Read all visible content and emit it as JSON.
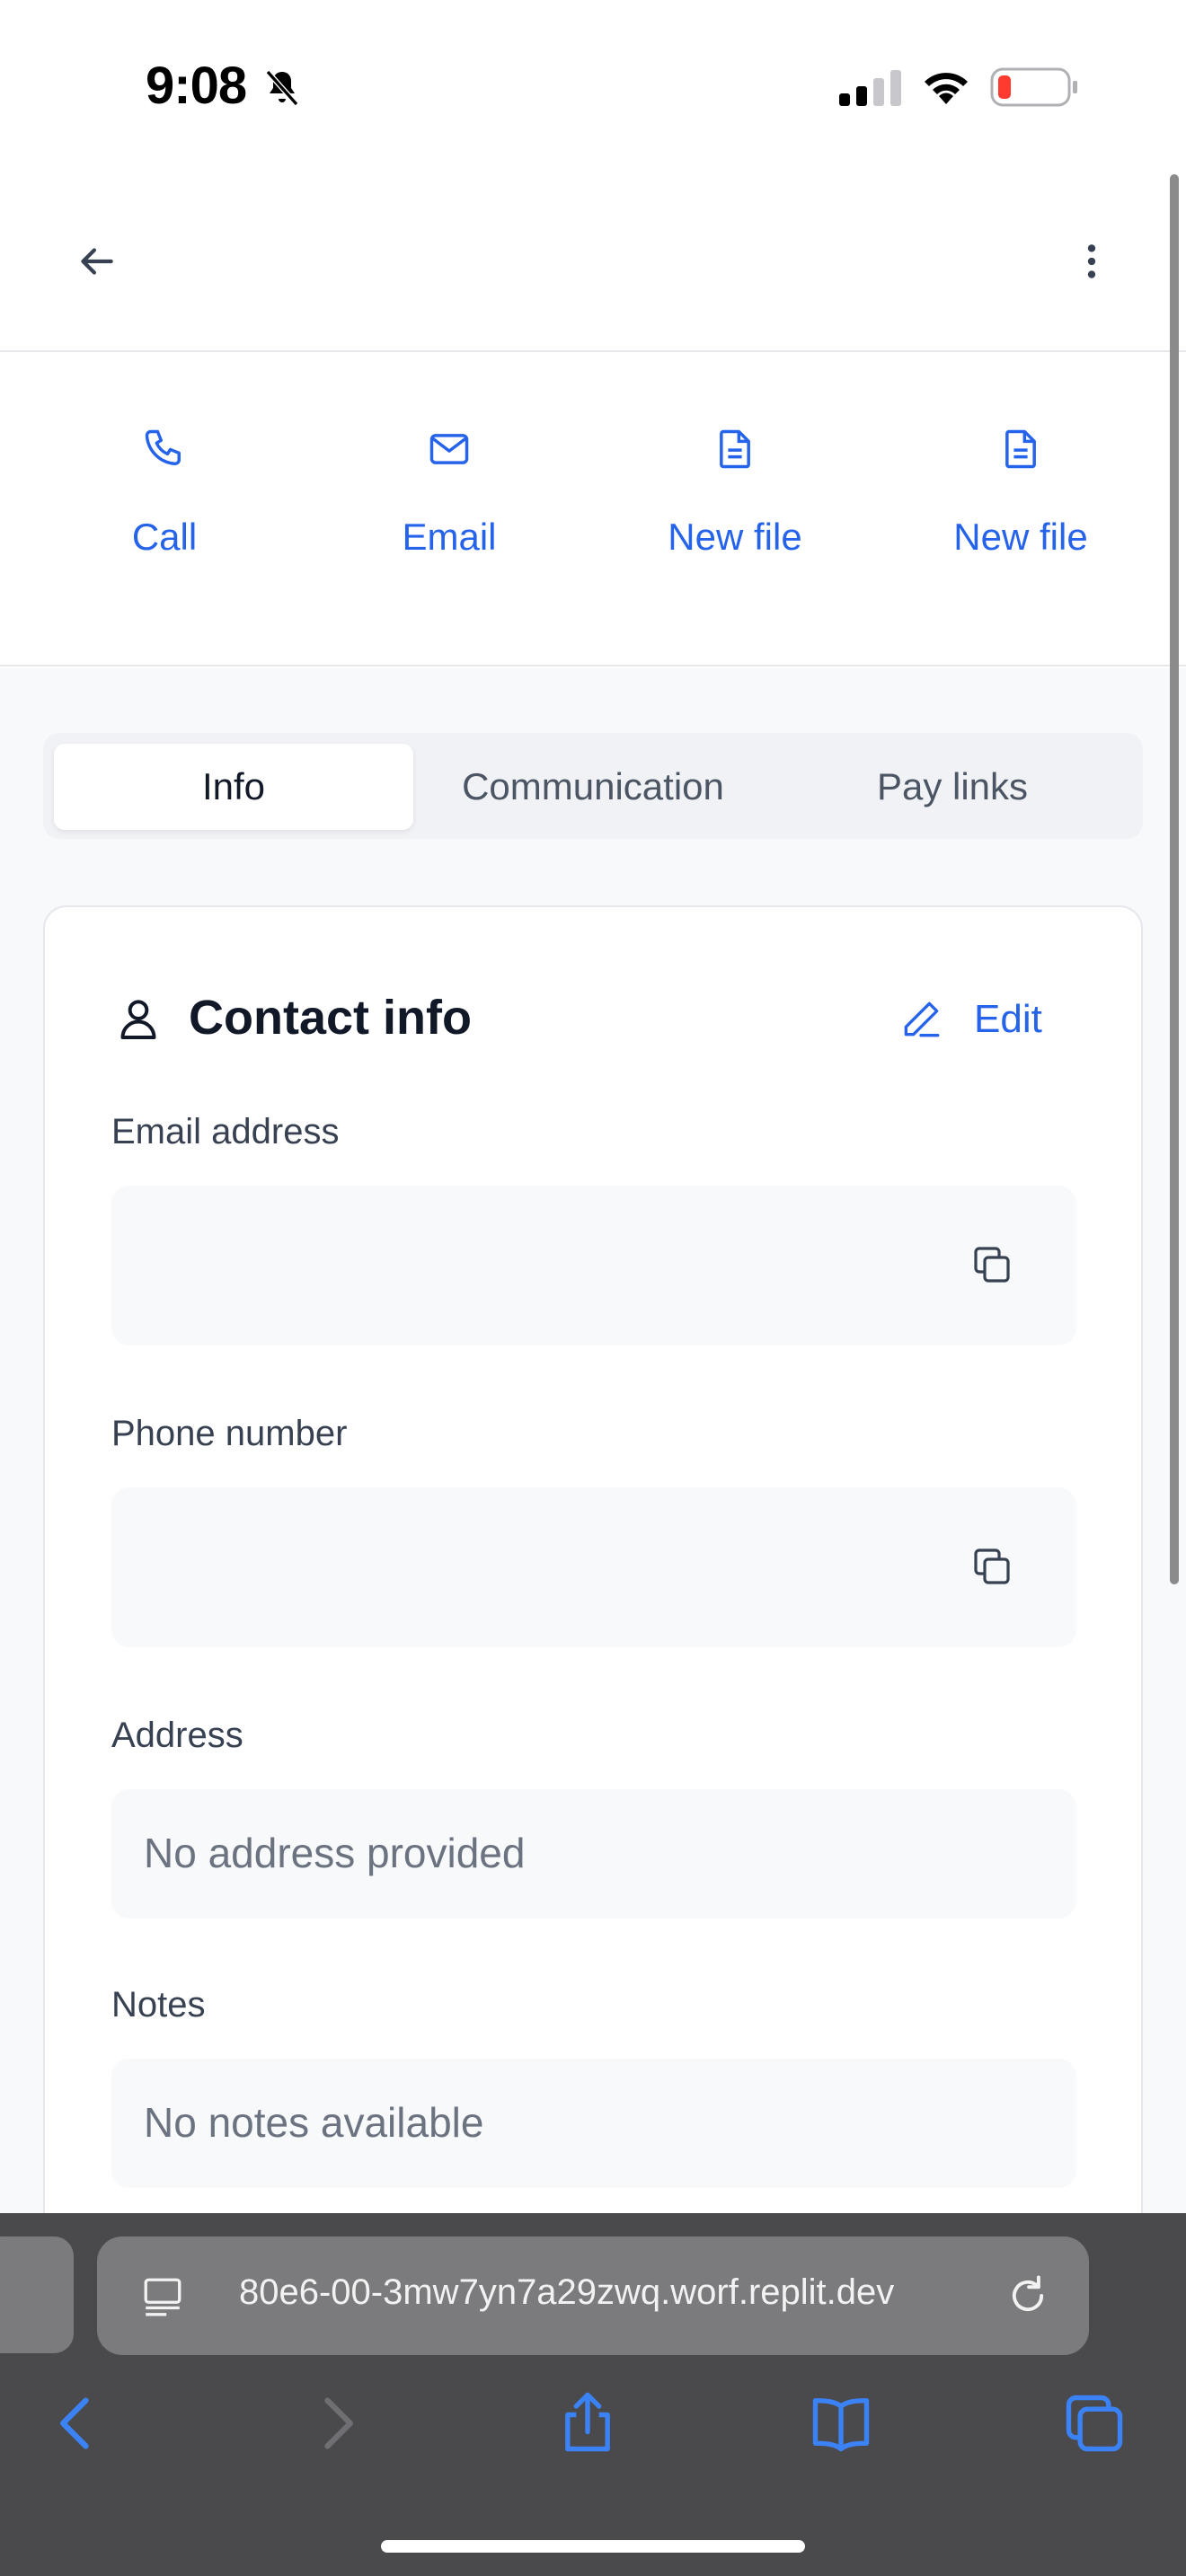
{
  "status_bar": {
    "time": "9:08",
    "battery_color": "#ff3b30"
  },
  "actions": [
    {
      "label": "Call",
      "icon": "phone-icon"
    },
    {
      "label": "Email",
      "icon": "mail-icon"
    },
    {
      "label": "New file",
      "icon": "file-icon"
    },
    {
      "label": "New file",
      "icon": "file-icon"
    }
  ],
  "tabs": [
    {
      "label": "Info",
      "active": true
    },
    {
      "label": "Communication",
      "active": false
    },
    {
      "label": "Pay links",
      "active": false
    }
  ],
  "contact_card": {
    "title": "Contact info",
    "edit_label": "Edit",
    "fields": {
      "email_label": "Email address",
      "email_value": "",
      "phone_label": "Phone number",
      "phone_value": "",
      "address_label": "Address",
      "address_value": "No address provided",
      "notes_label": "Notes",
      "notes_value": "No notes available"
    }
  },
  "browser": {
    "url": "80e6-00-3mw7yn7a29zwq.worf.replit.dev"
  },
  "colors": {
    "accent": "#2563eb",
    "muted_text": "#6b7280",
    "field_bg": "#f8f9fb"
  }
}
